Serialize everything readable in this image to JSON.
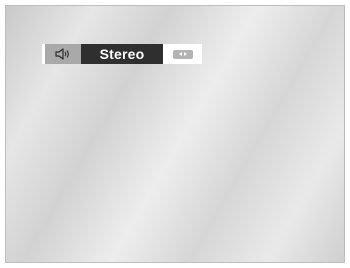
{
  "osd": {
    "mode_label": "Stereo",
    "icon": "speaker-icon",
    "selector_icon": "left-right-arrows-icon"
  },
  "colors": {
    "label_bg": "#2f2f2f",
    "icon_bg": "#a9a9a9",
    "label_text": "#ffffff",
    "arrow_pill": "#b3b3b3"
  }
}
